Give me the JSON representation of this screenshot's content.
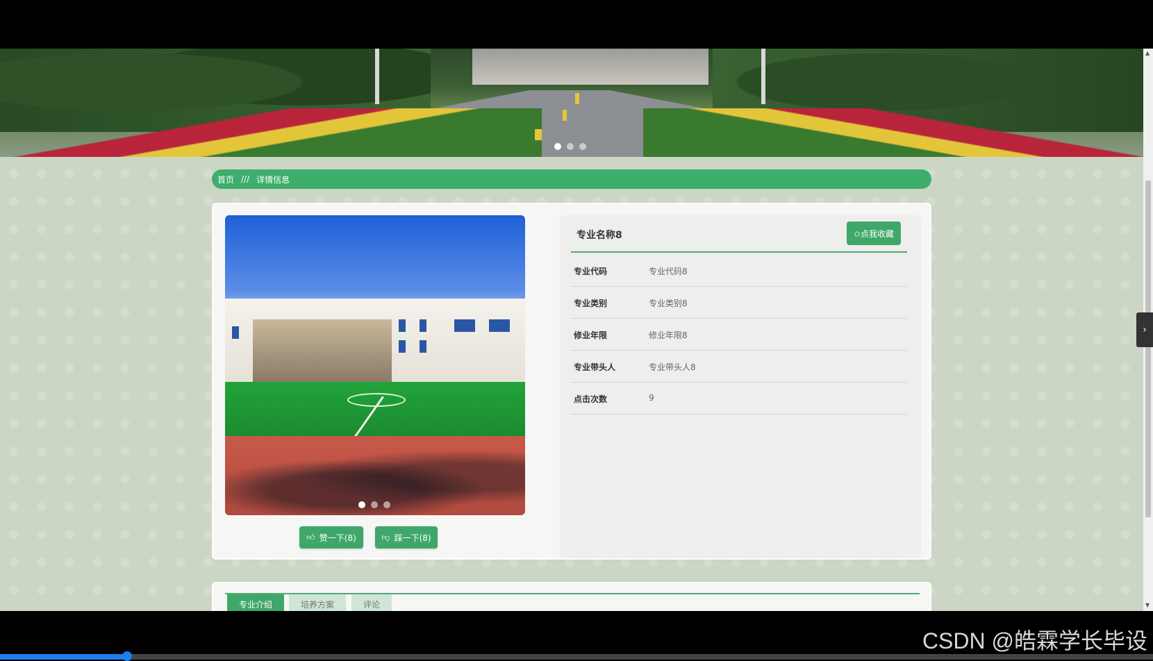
{
  "breadcrumb": {
    "home": "首页",
    "separator": "///",
    "current": "详情信息"
  },
  "detail": {
    "title": "专业名称8",
    "favorite_label": "✩点我收藏",
    "fields": [
      {
        "label": "专业代码",
        "value": "专业代码8"
      },
      {
        "label": "专业类别",
        "value": "专业类别8"
      },
      {
        "label": "修业年限",
        "value": "修业年限8"
      },
      {
        "label": "专业带头人",
        "value": "专业带头人8"
      },
      {
        "label": "点击次数",
        "value": "9"
      }
    ],
    "like_label": "赞一下(8)",
    "dislike_label": "踩一下(8)"
  },
  "tabs": [
    {
      "label": "专业介绍"
    },
    {
      "label": "培养方案"
    },
    {
      "label": "评论"
    }
  ],
  "carousel": {
    "hero_slides": 3,
    "hero_active": 1,
    "photo_slides": 3,
    "photo_active": 1
  },
  "watermark": "CSDN @皓霖学长毕设",
  "video_progress": 0.11,
  "colors": {
    "accent": "#3fa769",
    "breadcrumb": "#3dae6c",
    "background": "#cbd6c5"
  },
  "icons": {
    "like": "thumb-up-icon",
    "dislike": "thumb-down-icon",
    "side_toggle": "chevron-right-icon"
  }
}
